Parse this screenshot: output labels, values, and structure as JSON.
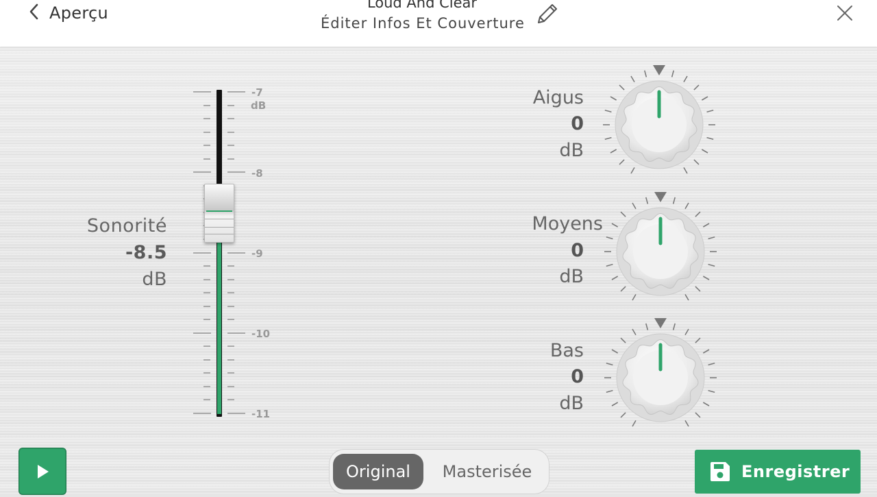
{
  "header": {
    "back_label": "Aperçu",
    "title": "Loud And Clear",
    "subtitle": "Éditer Infos Et Couverture",
    "icons": {
      "back": "chevron-left-icon",
      "edit": "pencil-icon",
      "close": "close-icon"
    }
  },
  "loudness": {
    "label": "Sonorité",
    "value": "-8.5",
    "unit": "dB",
    "scale": {
      "top": "-7",
      "top_unit": "dB",
      "labels": [
        "-8",
        "-9",
        "-10",
        "-11"
      ]
    },
    "level_db": -8.5,
    "range_db": [
      -11,
      -7
    ]
  },
  "eq": {
    "treble": {
      "label": "Aigus",
      "value": "0",
      "unit": "dB"
    },
    "mid": {
      "label": "Moyens",
      "value": "0",
      "unit": "dB"
    },
    "bass": {
      "label": "Bas",
      "value": "0",
      "unit": "dB"
    }
  },
  "bottom": {
    "play_icon": "play-icon",
    "mode_original": "Original",
    "mode_mastered": "Masterisée",
    "mode_selected": "Original",
    "save_label": "Enregistrer",
    "save_icon": "save-icon"
  },
  "colors": {
    "accent": "#2fa46a",
    "segment_selected": "#666666"
  }
}
